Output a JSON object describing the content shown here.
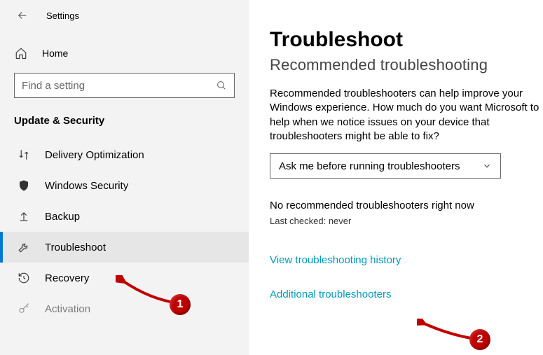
{
  "header": {
    "app_title": "Settings"
  },
  "home": {
    "label": "Home"
  },
  "search": {
    "placeholder": "Find a setting"
  },
  "section": {
    "title": "Update & Security"
  },
  "nav": [
    {
      "label": "Delivery Optimization",
      "icon": "swap-icon",
      "active": false
    },
    {
      "label": "Windows Security",
      "icon": "shield-icon",
      "active": false
    },
    {
      "label": "Backup",
      "icon": "upload-icon",
      "active": false
    },
    {
      "label": "Troubleshoot",
      "icon": "wrench-icon",
      "active": true
    },
    {
      "label": "Recovery",
      "icon": "history-icon",
      "active": false
    },
    {
      "label": "Activation",
      "icon": "key-icon",
      "active": false
    }
  ],
  "page": {
    "title": "Troubleshoot",
    "subtitle": "Recommended troubleshooting",
    "para": "Recommended troubleshooters can help improve your Windows experience. How much do you want Microsoft to help when we notice issues on your device that troubleshooters might be able to fix?",
    "dropdown_value": "Ask me before running troubleshooters",
    "status": "No recommended troubleshooters right now",
    "last_checked": "Last checked: never",
    "link_history": "View troubleshooting history",
    "link_additional": "Additional troubleshooters"
  },
  "annotations": {
    "badge1": "1",
    "badge2": "2"
  }
}
